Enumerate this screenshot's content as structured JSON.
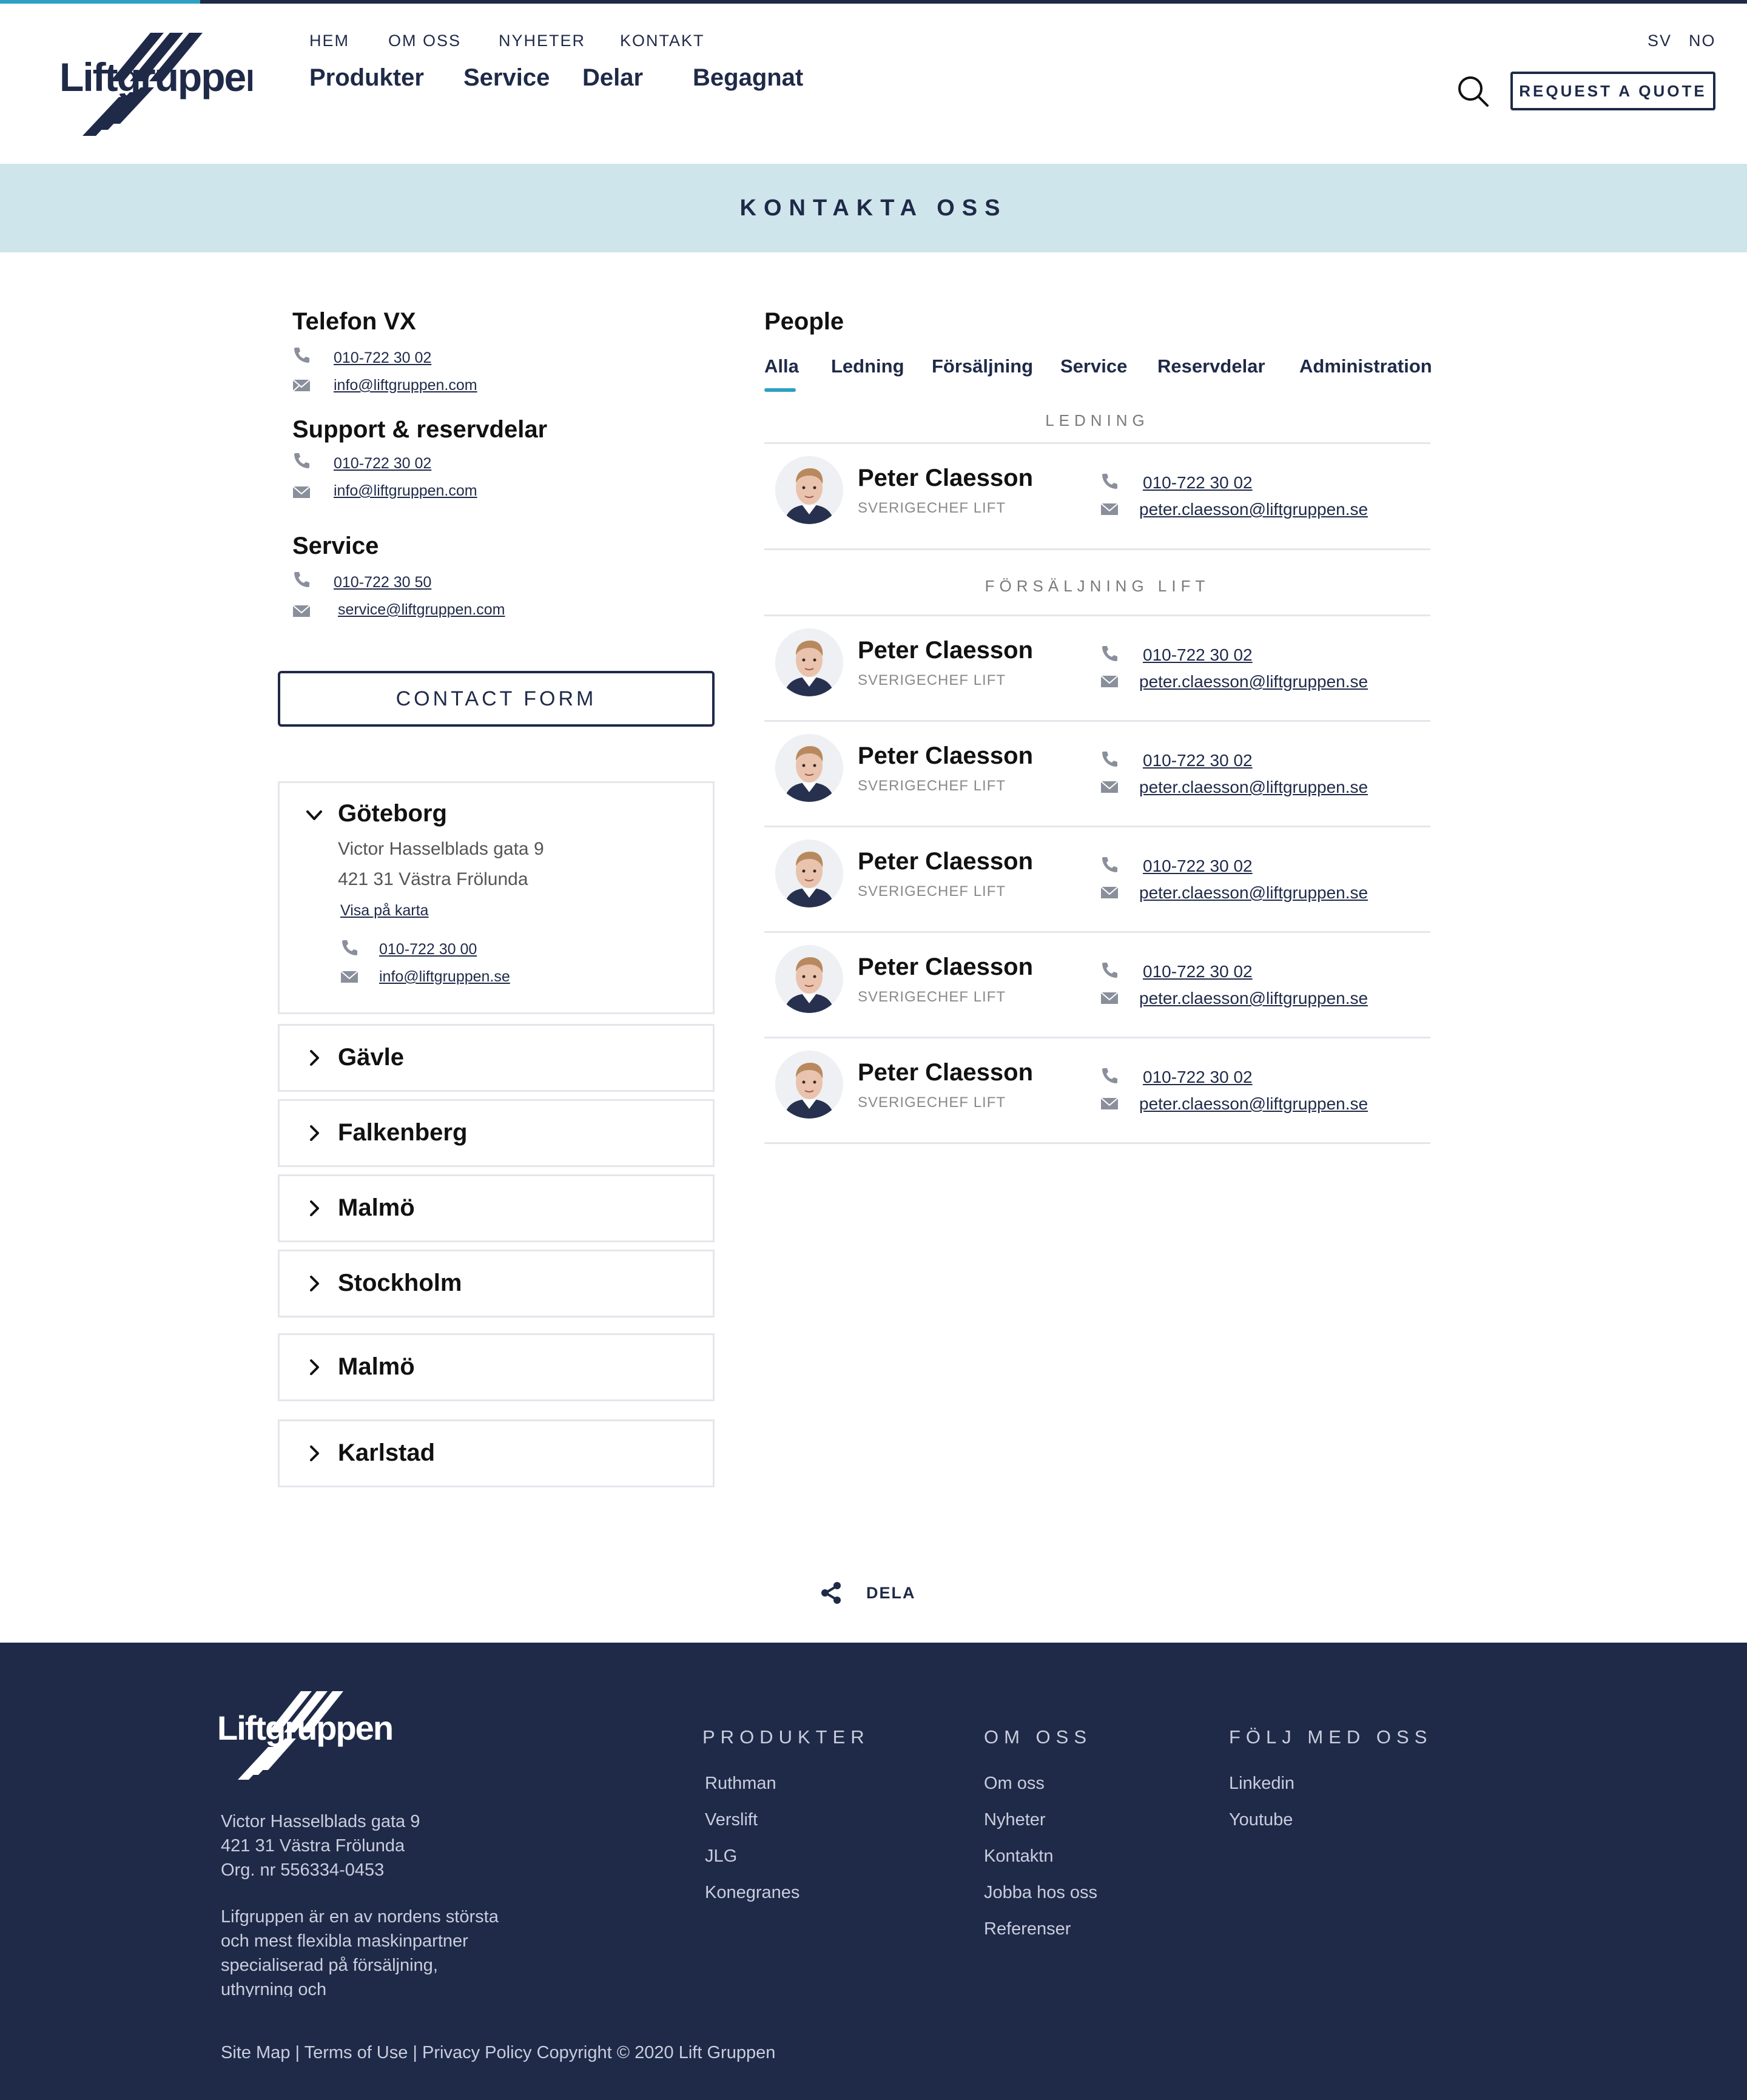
{
  "header": {
    "logo_text": "Liftgruppen",
    "top_nav": [
      "HEM",
      "OM OSS",
      "NYHETER",
      "KONTAKT"
    ],
    "main_nav": [
      "Produkter",
      "Service",
      "Delar",
      "Begagnat"
    ],
    "languages": [
      "SV",
      "NO"
    ],
    "quote_button": "REQUEST A QUOTE",
    "search_icon": "search-icon"
  },
  "banner": {
    "title": "KONTAKTA OSS"
  },
  "contacts": {
    "telefon_vx": {
      "title": "Telefon VX",
      "phone": "010-722 30 02",
      "email": "info@liftgruppen.com"
    },
    "support": {
      "title": "Support & reservdelar",
      "phone": "010-722 30 02",
      "email": "info@liftgruppen.com"
    },
    "service": {
      "title": "Service",
      "phone": "010-722 30 50",
      "email": "service@liftgruppen.com"
    },
    "contact_form_button": "CONTACT FORM"
  },
  "offices": {
    "open": {
      "name": "Göteborg",
      "address_1": "Victor Hasselblads gata 9",
      "address_2": "421 31 Västra Frölunda",
      "map_link": "Visa på karta",
      "phone": "010-722 30 00",
      "email": "info@liftgruppen.se"
    },
    "collapsed": [
      "Gävle",
      "Falkenberg",
      "Malmö",
      "Stockholm",
      "Malmö",
      "Karlstad"
    ]
  },
  "people": {
    "title": "People",
    "tabs": [
      "Alla",
      "Ledning",
      "Försäljning",
      "Service",
      "Reservdelar",
      "Administration"
    ],
    "active_tab": "Alla",
    "groups": [
      {
        "label": "LEDNING"
      },
      {
        "label": "FÖRSÄLJNING LIFT"
      }
    ],
    "persons": [
      {
        "name": "Peter Claesson",
        "role": "SVERIGECHEF LIFT",
        "phone": "010-722 30 02",
        "email": "peter.claesson@liftgruppen.se"
      },
      {
        "name": "Peter Claesson",
        "role": "SVERIGECHEF LIFT",
        "phone": "010-722 30 02",
        "email": "peter.claesson@liftgruppen.se"
      },
      {
        "name": "Peter Claesson",
        "role": "SVERIGECHEF LIFT",
        "phone": "010-722 30 02",
        "email": "peter.claesson@liftgruppen.se"
      },
      {
        "name": "Peter Claesson",
        "role": "SVERIGECHEF LIFT",
        "phone": "010-722 30 02",
        "email": "peter.claesson@liftgruppen.se"
      },
      {
        "name": "Peter Claesson",
        "role": "SVERIGECHEF LIFT",
        "phone": "010-722 30 02",
        "email": "peter.claesson@liftgruppen.se"
      },
      {
        "name": "Peter Claesson",
        "role": "SVERIGECHEF LIFT",
        "phone": "010-722 30 02",
        "email": "peter.claesson@liftgruppen.se"
      }
    ]
  },
  "share": {
    "label": "DELA",
    "icon": "share-icon"
  },
  "footer": {
    "logo_text": "Liftgruppen",
    "address": "Victor Hasselblads gata 9\n421 31 Västra Frölunda\nOrg. nr 556334-0453",
    "description": "Lifgruppen  är en av nordens största och mest flexibla maskinpartner specialiserad på försäljning, uthyrning och",
    "columns": [
      {
        "heading": "PRODUKTER",
        "links": [
          "Ruthman",
          "Verslift",
          "JLG",
          "Konegranes"
        ]
      },
      {
        "heading": "OM OSS",
        "links": [
          "Om oss",
          "Nyheter",
          "Kontaktn",
          "Jobba hos oss",
          "Referenser"
        ]
      },
      {
        "heading": "FÖLJ MED OSS",
        "links": [
          "Linkedin",
          "Youtube"
        ]
      }
    ],
    "bottom": "Site Map | Terms of Use | Privacy Policy    Copyright © 2020 Lift Gruppen"
  },
  "colors": {
    "navy": "#1f2a48",
    "accent": "#2ea0c4",
    "banner": "#cfe5ec",
    "border": "#e4e6eb"
  }
}
